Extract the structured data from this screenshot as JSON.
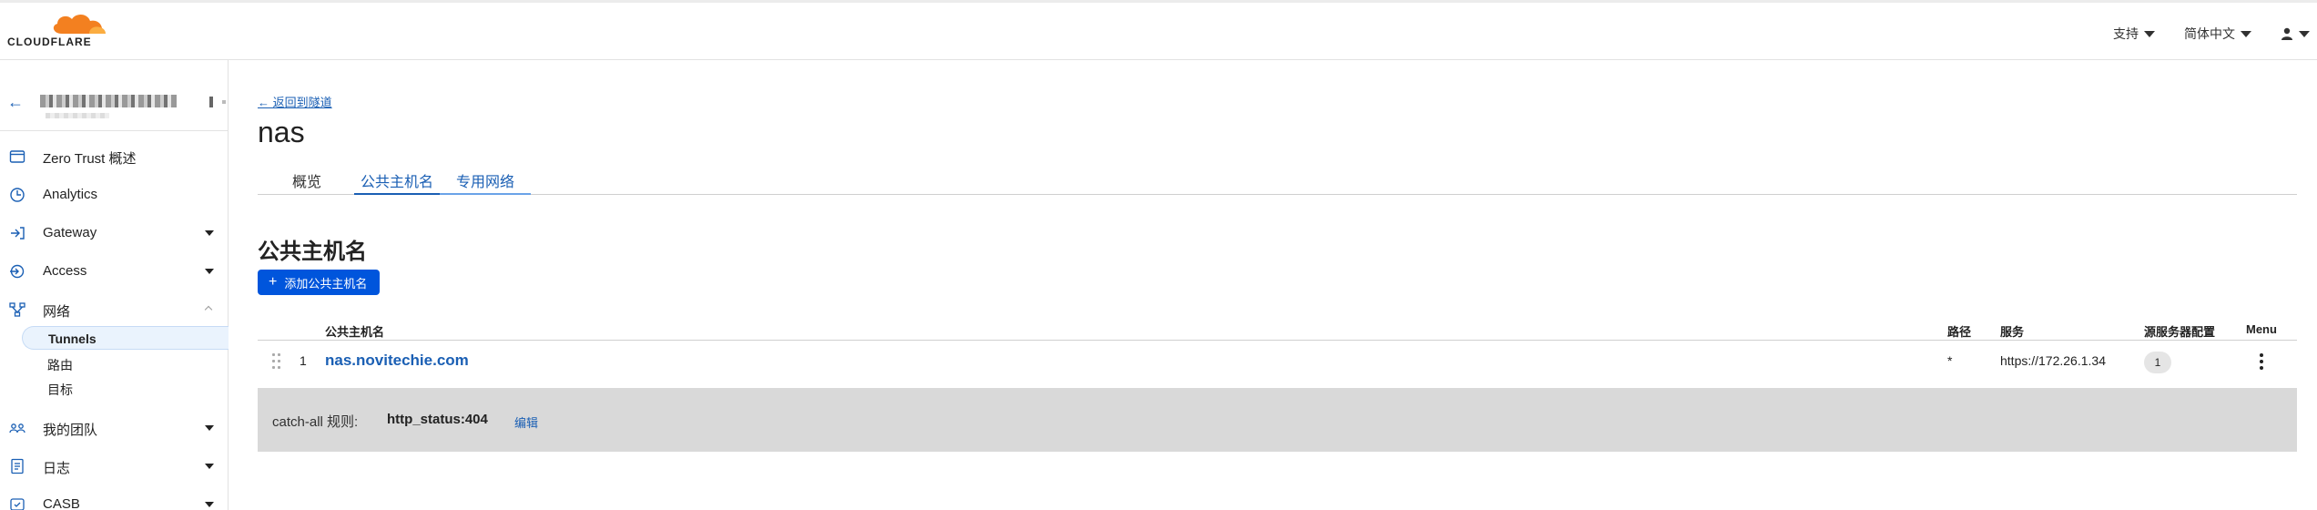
{
  "brand": {
    "wordmark": "CLOUDFLARE",
    "accent": "#f38020"
  },
  "topnav": {
    "support_label": "支持",
    "language_label": "简体中文",
    "user_icon": "user-icon"
  },
  "sidebar": {
    "back_icon": "arrow-left-icon",
    "items": [
      {
        "label": "Zero Trust 概述",
        "icon": "dashboard-icon",
        "expandable": false
      },
      {
        "label": "Analytics",
        "icon": "clock-icon",
        "expandable": false
      },
      {
        "label": "Gateway",
        "icon": "gateway-icon",
        "expandable": true
      },
      {
        "label": "Access",
        "icon": "access-icon",
        "expandable": true
      },
      {
        "label": "网络",
        "icon": "network-icon",
        "expandable": true,
        "expanded": true
      },
      {
        "label": "我的团队",
        "icon": "team-icon",
        "expandable": true
      },
      {
        "label": "日志",
        "icon": "log-icon",
        "expandable": true
      },
      {
        "label": "CASB",
        "icon": "casb-icon",
        "expandable": true
      }
    ],
    "network_sub": [
      {
        "label": "Tunnels",
        "active": true
      },
      {
        "label": "路由",
        "active": false
      },
      {
        "label": "目标",
        "active": false
      }
    ]
  },
  "main": {
    "back_link": "← 返回到隧道",
    "title": "nas",
    "tabs": [
      {
        "label": "概览"
      },
      {
        "label": "公共主机名"
      },
      {
        "label": "专用网络"
      }
    ],
    "section_title": "公共主机名",
    "add_button": "添加公共主机名",
    "table": {
      "columns": [
        "公共主机名",
        "路径",
        "服务",
        "源服务器配置",
        "Menu"
      ],
      "rows": [
        {
          "index": "1",
          "hostname": "nas.novitechie.com",
          "path": "*",
          "service": "https://172.26.1.34",
          "origin_config": "1"
        }
      ]
    },
    "catch_all": {
      "label": "catch-all 规则:",
      "value": "http_status:404",
      "edit_label": "编辑"
    }
  }
}
